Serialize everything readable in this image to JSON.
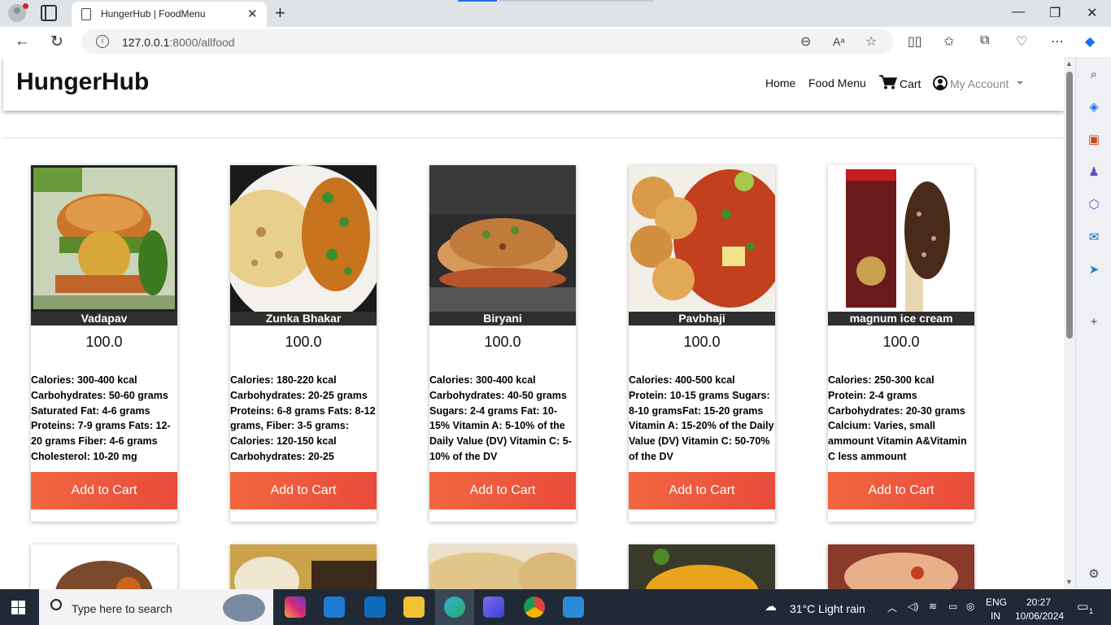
{
  "browser": {
    "tab_title": "HungerHub | FoodMenu",
    "url_host": "127.0.0.1",
    "url_path": ":8000/allfood"
  },
  "site": {
    "brand": "HungerHub",
    "nav": {
      "home": "Home",
      "menu": "Food Menu",
      "cart": "Cart",
      "account": "My Account"
    }
  },
  "foods": [
    {
      "name": "Vadapav",
      "price": "100.0",
      "description": "Calories: 300-400 kcal Carbohydrates: 50-60 grams Saturated Fat: 4-6 grams Proteins: 7-9 grams Fats: 12-20 grams Fiber: 4-6 grams Cholesterol: 10-20 mg",
      "button": "Add to Cart"
    },
    {
      "name": "Zunka Bhakar",
      "price": "100.0",
      "description": "Calories: 180-220 kcal Carbohydrates: 20-25 grams Proteins: 6-8 grams Fats: 8-12 grams, Fiber: 3-5 grams: Calories: 120-150 kcal Carbohydrates: 20-25",
      "button": "Add to Cart"
    },
    {
      "name": "Biryani",
      "price": "100.0",
      "description": "Calories: 300-400 kcal Carbohydrates: 40-50 grams Sugars: 2-4 grams Fat: 10-15% Vitamin A: 5-10% of the Daily Value (DV) Vitamin C: 5-10% of the DV",
      "button": "Add to Cart"
    },
    {
      "name": "Pavbhaji",
      "price": "100.0",
      "description": "Calories: 400-500 kcal Protein: 10-15 grams Sugars: 8-10 gramsFat: 15-20 grams Vitamin A: 15-20% of the Daily Value (DV) Vitamin C: 50-70% of the DV",
      "button": "Add to Cart"
    },
    {
      "name": "magnum ice cream",
      "price": "100.0",
      "description": "Calories: 250-300 kcal Protein: 2-4 grams Carbohydrates: 20-30 grams Calcium: Varies, small ammount Vitamin A&Vitamin C less ammount",
      "button": "Add to Cart"
    }
  ],
  "taskbar": {
    "search_placeholder": "Type here to search",
    "weather": "31°C  Light rain",
    "lang_line1": "ENG",
    "lang_line2": "IN",
    "time": "20:27",
    "date": "10/06/2024",
    "notification_count": "1"
  }
}
